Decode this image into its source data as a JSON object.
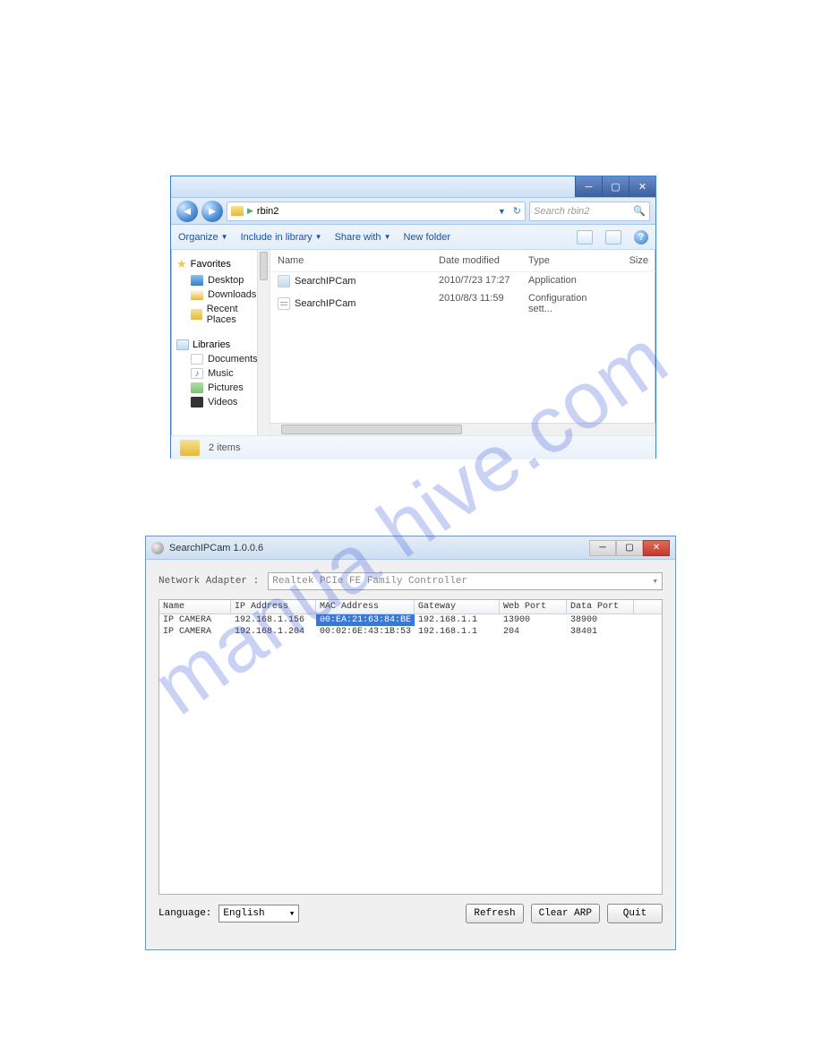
{
  "watermark": "manua   hive.com",
  "explorer": {
    "breadcrumb": "rbin2",
    "search_placeholder": "Search rbin2",
    "toolbar": {
      "organize": "Organize",
      "include": "Include in library",
      "share": "Share with",
      "newfolder": "New folder"
    },
    "nav": {
      "favorites": "Favorites",
      "desktop": "Desktop",
      "downloads": "Downloads",
      "recent": "Recent Places",
      "libraries": "Libraries",
      "documents": "Documents",
      "music": "Music",
      "pictures": "Pictures",
      "videos": "Videos"
    },
    "columns": {
      "name": "Name",
      "date": "Date modified",
      "type": "Type",
      "size": "Size"
    },
    "files": [
      {
        "name": "SearchIPCam",
        "date": "2010/7/23 17:27",
        "type": "Application"
      },
      {
        "name": "SearchIPCam",
        "date": "2010/8/3 11:59",
        "type": "Configuration sett..."
      }
    ],
    "status": "2 items"
  },
  "ipcam": {
    "title": "SearchIPCam 1.0.0.6",
    "adapter_label": "Network Adapter :",
    "adapter_value": "Realtek PCIe FE Family Controller",
    "columns": {
      "name": "Name",
      "ip": "IP Address",
      "mac": "MAC Address",
      "gw": "Gateway",
      "wp": "Web Port",
      "dp": "Data Port"
    },
    "rows": [
      {
        "name": "IP CAMERA",
        "ip": "192.168.1.156",
        "mac": "00:EA:21:63:84:BE",
        "gw": "192.168.1.1",
        "wp": "13900",
        "dp": "38900"
      },
      {
        "name": "IP CAMERA",
        "ip": "192.168.1.204",
        "mac": "00:02:6E:43:1B:53",
        "gw": "192.168.1.1",
        "wp": "204",
        "dp": "38401"
      }
    ],
    "language_label": "Language:",
    "language_value": "English",
    "buttons": {
      "refresh": "Refresh",
      "clear": "Clear ARP",
      "quit": "Quit"
    }
  }
}
